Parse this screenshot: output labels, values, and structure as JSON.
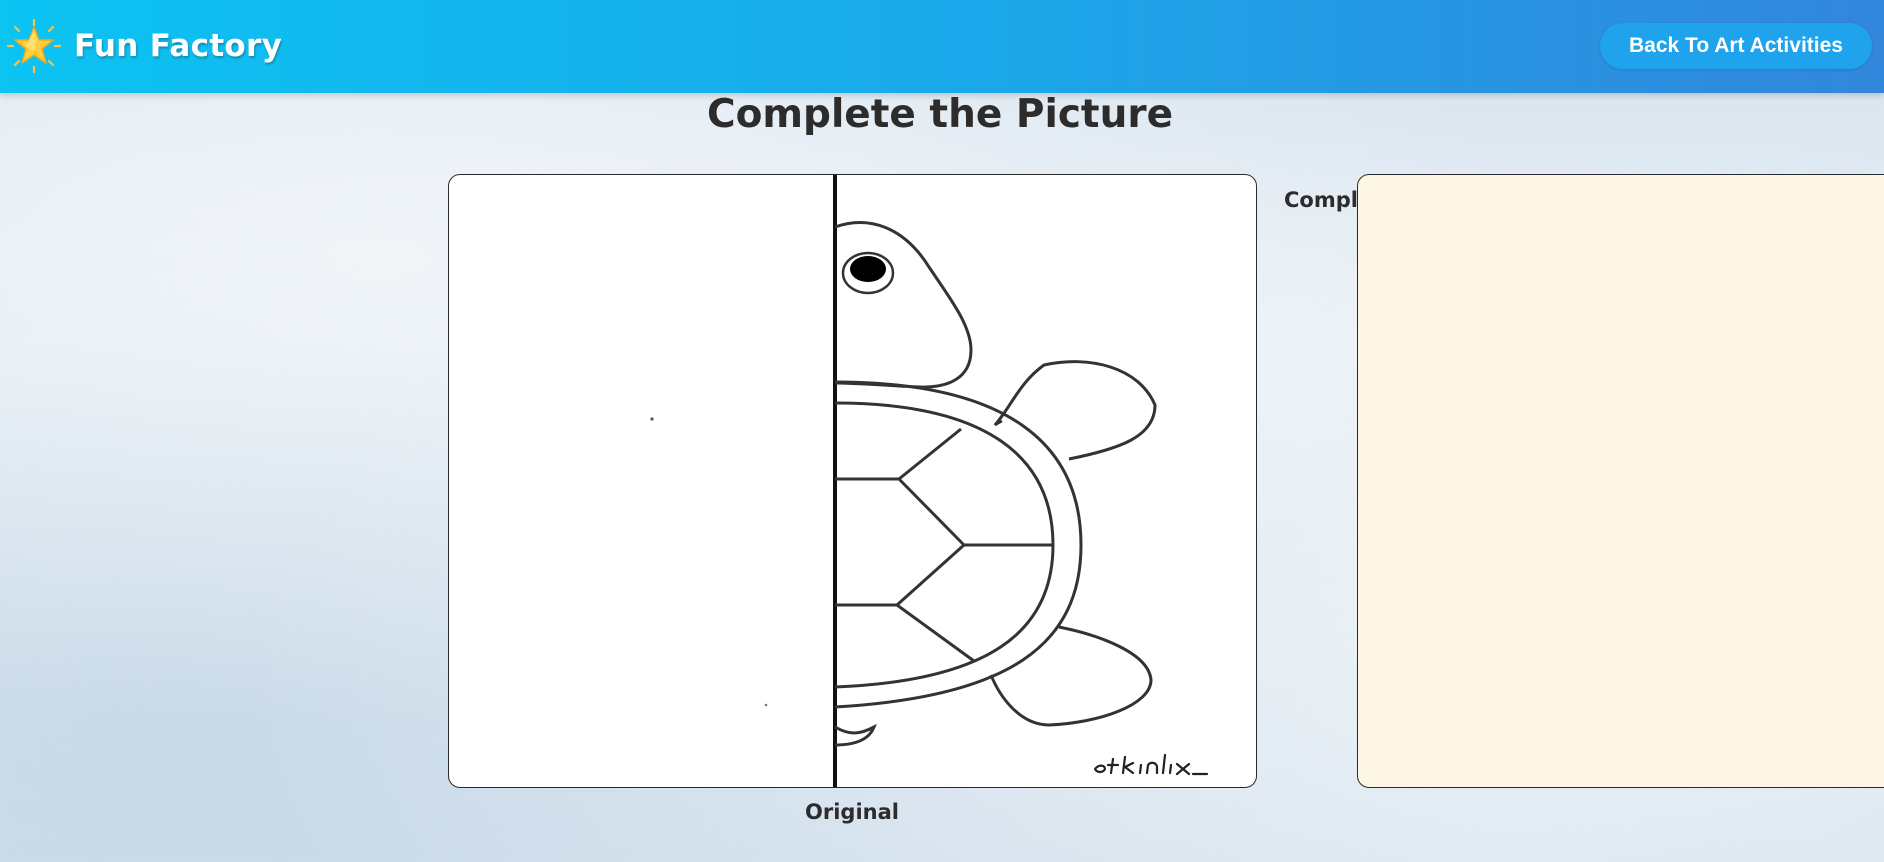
{
  "header": {
    "brand": "Fun Factory",
    "logo_icon": "star-icon",
    "back_label": "Back To Art Activities",
    "background_colors": [
      "#0cc3f2",
      "#3286dc"
    ]
  },
  "page": {
    "title": "Complete the Picture"
  },
  "original": {
    "caption": "Original",
    "signature": "etkinlix_"
  },
  "completion": {
    "caption": "Complete",
    "canvas_color": "#fdf6e5"
  }
}
